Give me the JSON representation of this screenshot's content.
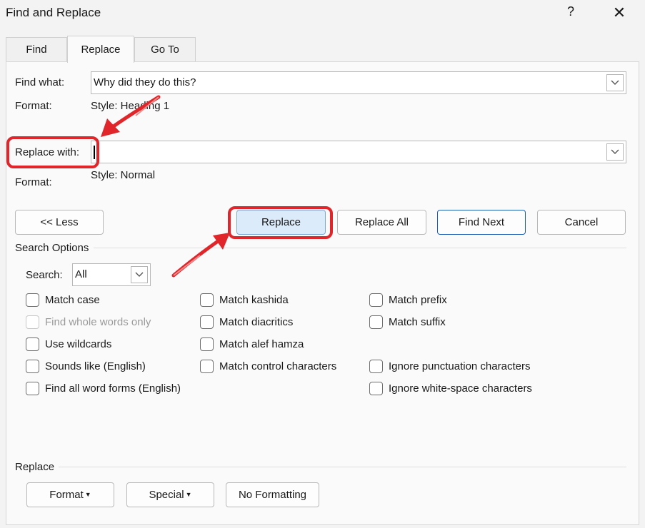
{
  "window": {
    "title": "Find and Replace",
    "help_label": "?",
    "close_label": "✕"
  },
  "tabs": [
    {
      "label": "Find"
    },
    {
      "label": "Replace"
    },
    {
      "label": "Go To"
    }
  ],
  "find": {
    "label": "Find what:",
    "value": "Why did they do this?",
    "format_label": "Format:",
    "format_value": "Style: Heading 1"
  },
  "replace": {
    "label": "Replace with:",
    "value": "",
    "format_label": "Format:",
    "format_value": "Style: Normal"
  },
  "buttons": {
    "less": "<< Less",
    "replace": "Replace",
    "replace_all": "Replace All",
    "find_next": "Find Next",
    "cancel": "Cancel"
  },
  "search_options": {
    "heading": "Search Options",
    "search_label": "Search:",
    "search_value": "All",
    "col1": [
      {
        "label": "Match case",
        "checked": false,
        "disabled": false
      },
      {
        "label": "Find whole words only",
        "checked": false,
        "disabled": true
      },
      {
        "label": "Use wildcards",
        "checked": false,
        "disabled": false
      },
      {
        "label": "Sounds like (English)",
        "checked": false,
        "disabled": false
      },
      {
        "label": "Find all word forms (English)",
        "checked": false,
        "disabled": false
      }
    ],
    "col2": [
      {
        "label": "Match kashida",
        "checked": false
      },
      {
        "label": "Match diacritics",
        "checked": false
      },
      {
        "label": "Match alef hamza",
        "checked": false
      },
      {
        "label": "Match control characters",
        "checked": false
      }
    ],
    "col3a": [
      {
        "label": "Match prefix",
        "checked": false
      },
      {
        "label": "Match suffix",
        "checked": false
      }
    ],
    "col3b": [
      {
        "label": "Ignore punctuation characters",
        "checked": false
      },
      {
        "label": "Ignore white-space characters",
        "checked": false
      }
    ]
  },
  "replace_section": {
    "heading": "Replace",
    "format_btn": "Format",
    "special_btn": "Special",
    "no_formatting_btn": "No Formatting"
  },
  "icons": {
    "close": "close-icon",
    "help": "help-icon",
    "dropdown": "chevron-down-icon",
    "arrows": "annotation-arrow-icon"
  },
  "colors": {
    "annotation": "#e0262b",
    "primary_border": "#1f5fb3",
    "highlight_button": "#dcebfa"
  }
}
